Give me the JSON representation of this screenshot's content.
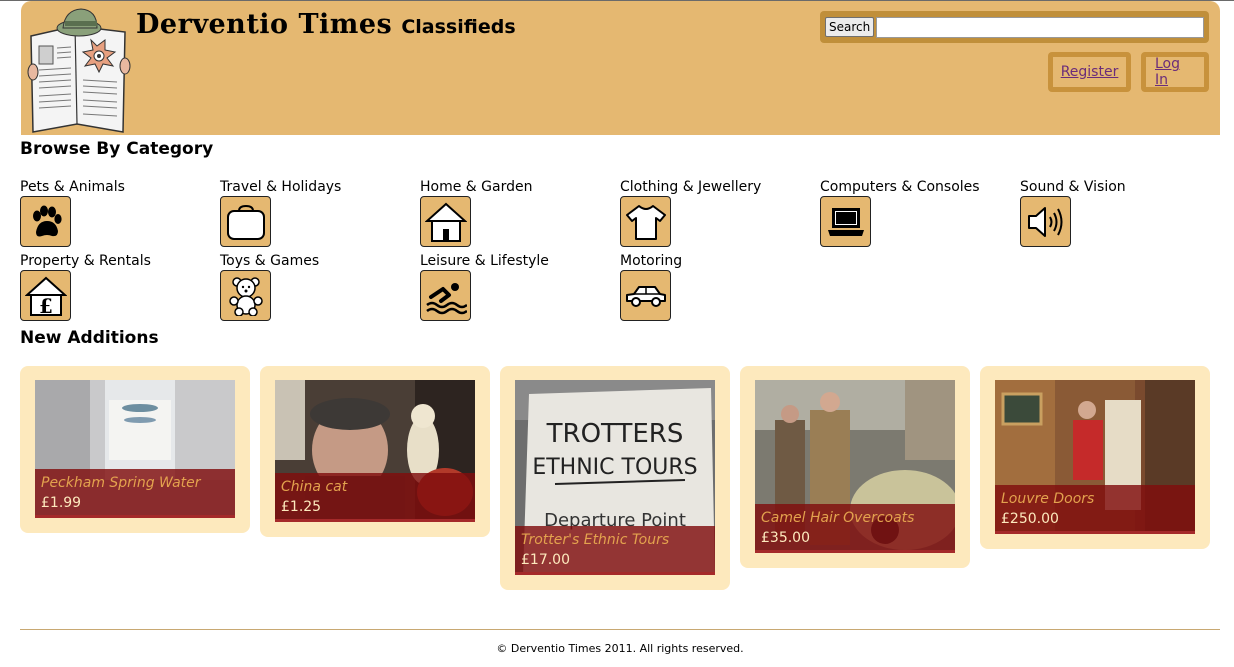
{
  "header": {
    "site_name": "Derventio Times",
    "subtitle": "Classifieds",
    "search_button": "Search",
    "search_value": "",
    "register": "Register",
    "login": "Log In"
  },
  "browse": {
    "title": "Browse By Category",
    "categories": [
      {
        "label": "Pets & Animals",
        "icon": "paw-icon"
      },
      {
        "label": "Travel & Holidays",
        "icon": "suitcase-icon"
      },
      {
        "label": "Home & Garden",
        "icon": "house-icon"
      },
      {
        "label": "Clothing & Jewellery",
        "icon": "tshirt-icon"
      },
      {
        "label": "Computers & Consoles",
        "icon": "laptop-icon"
      },
      {
        "label": "Sound & Vision",
        "icon": "speaker-icon"
      },
      {
        "label": "Property & Rentals",
        "icon": "house-pound-icon"
      },
      {
        "label": "Toys & Games",
        "icon": "teddy-bear-icon"
      },
      {
        "label": "Leisure & Lifestyle",
        "icon": "swimmer-icon"
      },
      {
        "label": "Motoring",
        "icon": "car-icon"
      }
    ]
  },
  "additions": {
    "title": "New Additions",
    "items": [
      {
        "title": "Peckham Spring Water",
        "price": "£1.99"
      },
      {
        "title": "China cat",
        "price": "£1.25"
      },
      {
        "title": "Trotter's Ethnic Tours",
        "price": "£17.00",
        "sign_text": "TROTTERS ETHNIC TOURS",
        "sign_sub": "Departure Point"
      },
      {
        "title": "Camel Hair Overcoats",
        "price": "£35.00"
      },
      {
        "title": "Louvre Doors",
        "price": "£250.00"
      }
    ]
  },
  "footer": {
    "copyright": "© Derventio Times 2011. All rights reserved."
  },
  "colors": {
    "header_bg": "#e5b871",
    "card_bg": "#fde9bd",
    "caption_bg": "#800e0e",
    "link": "#6a2c7a"
  }
}
